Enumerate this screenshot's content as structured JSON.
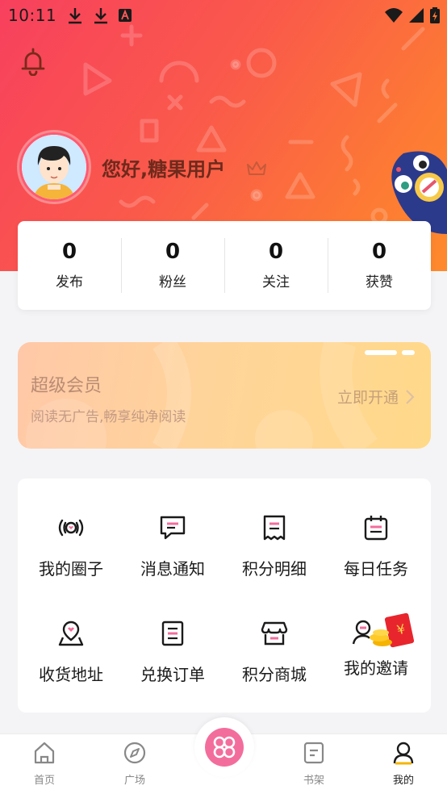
{
  "status_bar": {
    "time": "10:11"
  },
  "profile": {
    "greeting": "您好,糖果用户"
  },
  "stats": [
    {
      "value": "0",
      "label": "发布"
    },
    {
      "value": "0",
      "label": "粉丝"
    },
    {
      "value": "0",
      "label": "关注"
    },
    {
      "value": "0",
      "label": "获赞"
    }
  ],
  "vip": {
    "title": "超级会员",
    "subtitle": "阅读无广告,畅享纯净阅读",
    "action": "立即开通"
  },
  "menu": [
    {
      "label": "我的圈子",
      "icon": "circle-broadcast-icon"
    },
    {
      "label": "消息通知",
      "icon": "message-icon"
    },
    {
      "label": "积分明细",
      "icon": "receipt-icon"
    },
    {
      "label": "每日任务",
      "icon": "calendar-icon"
    },
    {
      "label": "收货地址",
      "icon": "location-icon"
    },
    {
      "label": "兑换订单",
      "icon": "order-icon"
    },
    {
      "label": "积分商城",
      "icon": "store-icon"
    },
    {
      "label": "我的邀请",
      "icon": "invite-icon"
    }
  ],
  "tabbar": [
    {
      "label": "首页",
      "icon": "home-icon"
    },
    {
      "label": "广场",
      "icon": "compass-icon"
    },
    {
      "label": "",
      "icon": "center-app-icon"
    },
    {
      "label": "书架",
      "icon": "bookshelf-icon"
    },
    {
      "label": "我的",
      "icon": "profile-icon",
      "active": true
    }
  ],
  "colors": {
    "header_start": "#f8405e",
    "header_end": "#fe8a2c",
    "accent_pink": "#f36d9c",
    "vip_gold": "#ffd49a"
  }
}
